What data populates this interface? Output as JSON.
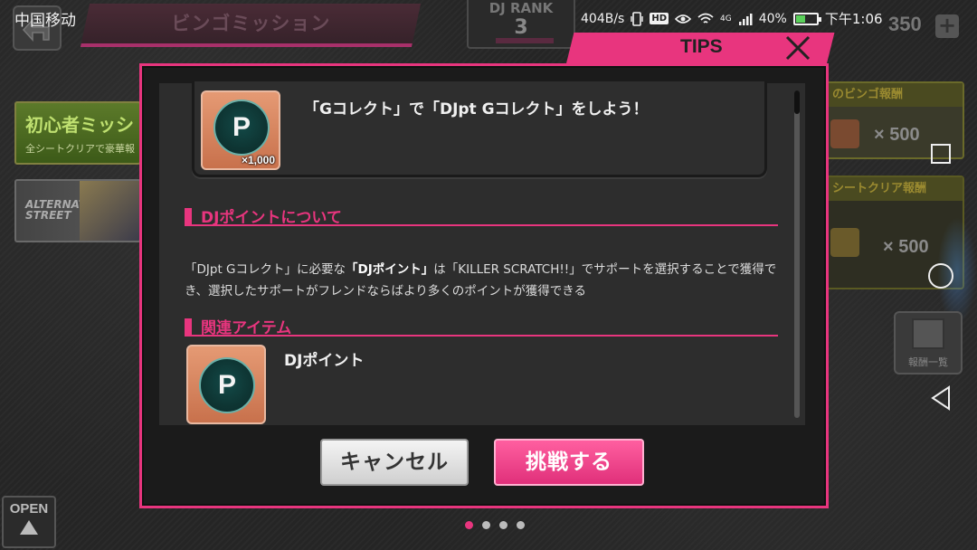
{
  "status_bar": {
    "carrier": "中国移动",
    "net_speed": "404B/s",
    "hd_badge": "HD",
    "network_type": "4G",
    "battery": "40%",
    "time": "下午1:06"
  },
  "game_header": {
    "screen_title": "ビンゴミッション",
    "rank_label": "DJ RANK",
    "rank_value": "3",
    "currency_count": "350",
    "plus_label": "+"
  },
  "left_banners": {
    "beginner_title": "初心者ミッシ",
    "beginner_subtitle": "全シートクリアで豪華報",
    "alt_title": "ALTERNATIVE STREET"
  },
  "right_rewards": {
    "bingo_reward_label": "のビンゴ報酬",
    "bingo_reward_value": "× 500",
    "sheet_clear_label": "シートクリア報酬",
    "sheet_clear_value": "× 500",
    "gift_list_label": "報酬一覧"
  },
  "open_button": {
    "label": "OPEN"
  },
  "pagination": {
    "count": 4,
    "active": 0
  },
  "modal": {
    "header_label": "TIPS",
    "mission": {
      "text": "「Gコレクト」で「DJpt Gコレクト」をしよう！",
      "coin_letter": "P",
      "coin_ring": "DJ POINT",
      "quantity": "×1,000"
    },
    "section_djpoint_title": "DJポイントについて",
    "description": {
      "part1": "「DJpt Gコレクト」に必要な",
      "bold": "「DJポイント」",
      "part2": "は「KILLER SCRATCH!!」でサポートを選択することで獲得でき、選択したサポートがフレンドならばより多くのポイントが獲得できる"
    },
    "section_items_title": "関連アイテム",
    "related_item": {
      "name": "DJポイント",
      "coin_letter": "P"
    },
    "cancel_label": "キャンセル",
    "challenge_label": "挑戦する"
  },
  "colors": {
    "accent": "#e8357e",
    "modal_bg": "#2d2d2d",
    "coin_tile": "#d98560",
    "coin_face": "#0e3533"
  }
}
